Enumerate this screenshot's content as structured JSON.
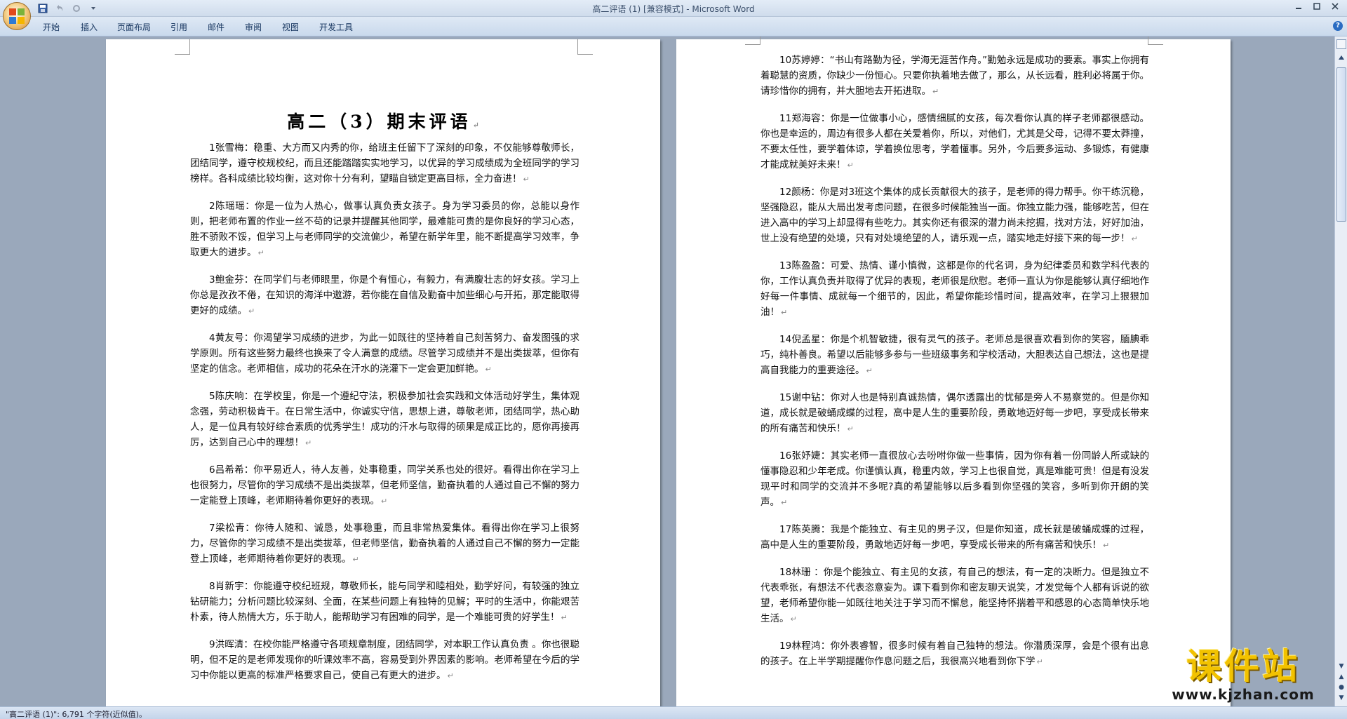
{
  "window": {
    "title": "高二评语 (1) [兼容模式] - Microsoft Word"
  },
  "ribbon": {
    "tabs": [
      "开始",
      "插入",
      "页面布局",
      "引用",
      "邮件",
      "审阅",
      "视图",
      "开发工具"
    ]
  },
  "document": {
    "title": "高二（3）期末评语",
    "page1_paragraphs": [
      "1张雪梅：稳重、大方而又内秀的你，给班主任留下了深刻的印象，不仅能够尊敬师长，团结同学，遵守校规校纪，而且还能踏踏实实地学习，以优异的学习成绩成为全班同学的学习榜样。各科成绩比较均衡，这对你十分有利，望瞄自锁定更高目标，全力奋进！",
      "2陈瑶瑶：你是一位为人热心，做事认真负责女孩子。身为学习委员的你，总能以身作则，把老师布置的作业一丝不苟的记录并提醒其他同学，最难能可贵的是你良好的学习心态，胜不骄败不馁，但学习上与老师同学的交流偏少，希望在新学年里，能不断提高学习效率，争取更大的进步。",
      "3鲍金芬：在同学们与老师眼里，你是个有恒心，有毅力，有满腹壮志的好女孩。学习上你总是孜孜不倦，在知识的海洋中遨游，若你能在自信及勤奋中加些细心与开拓，那定能取得更好的成绩。",
      "4黄友号：你渴望学习成绩的进步，为此一如既往的坚持着自己刻苦努力、奋发图强的求学原则。所有这些努力最终也换来了令人满意的成绩。尽管学习成绩并不是出类拔萃，但你有坚定的信念。老师相信，成功的花朵在汗水的浇灌下一定会更加鲜艳。",
      "5陈庆响：在学校里，你是一个遵纪守法，积极参加社会实践和文体活动好学生，集体观念强，劳动积极肯干。在日常生活中，你诚实守信，思想上进，尊敬老师，团结同学，热心助人，是一位具有较好综合素质的优秀学生！成功的汗水与取得的硕果是成正比的，愿你再接再厉，达到自己心中的理想！",
      "6吕希希：你平易近人，待人友善，处事稳重，同学关系也处的很好。看得出你在学习上也很努力，尽管你的学习成绩不是出类拔萃，但老师坚信，勤奋执着的人通过自己不懈的努力一定能登上顶峰，老师期待着你更好的表现。",
      "7梁松青：你待人随和、诚恳，处事稳重，而且非常热爱集体。看得出你在学习上很努力，尽管你的学习成绩不是出类拔萃，但老师坚信，勤奋执着的人通过自己不懈的努力一定能登上顶峰，老师期待着你更好的表现。",
      "8肖新宇：你能遵守校纪班规，尊敬师长，能与同学和睦相处，勤学好问，有较强的独立钻研能力；分析问题比较深刻、全面，在某些问题上有独特的见解；平时的生活中，你能艰苦朴素，待人热情大方，乐于助人，能帮助学习有困难的同学，是一个难能可贵的好学生！",
      "9洪晖清：在校你能严格遵守各项规章制度，团结同学，对本职工作认真负责 。你也很聪明，但不足的是老师发现你的听课效率不高，容易受到外界因素的影响。老师希望在今后的学习中你能以更高的标准严格要求自己，使自己有更大的进步。"
    ],
    "page2_paragraphs": [
      "10苏婷婷：“书山有路勤为径，学海无涯苦作舟。”勤勉永远是成功的要素。事实上你拥有着聪慧的资质，你缺少一份恒心。只要你执着地去做了，那么，从长远看，胜利必将属于你。请珍惜你的拥有，并大胆地去开拓进取。",
      "11郑海容：你是一位做事小心，感情细腻的女孩，每次看你认真的样子老师都很感动。你也是幸运的，周边有很多人都在关爱着你，所以，对他们，尤其是父母，记得不要太莽撞，不要太任性，要学着体谅，学着换位思考，学着懂事。另外，今后要多运动、多锻炼，有健康才能成就美好未来！",
      "12颜杨：你是对3班这个集体的成长贡献很大的孩子，是老师的得力帮手。你干练沉稳，坚强隐忍，能从大局出发考虑问题，在很多时候能独当一面。你独立能力强，能够吃苦，但在进入高中的学习上却显得有些吃力。其实你还有很深的潜力尚未挖掘，找对方法，好好加油，世上没有绝望的处境，只有对处境绝望的人，请乐观一点，踏实地走好接下来的每一步！",
      "13陈盈盈：可爱、热情、谨小慎微，这都是你的代名词，身为纪律委员和数学科代表的你，工作认真负责并取得了优异的表现，老师很是欣慰。老师一直认为你是能够认真仔细地作好每一件事情、成就每一个细节的，因此，希望你能珍惜时间，提高效率，在学习上狠狠加油！",
      "14倪孟星：你是个机智敏捷，很有灵气的孩子。老师总是很喜欢看到你的笑容，腼腆乖巧，纯朴善良。希望以后能够多参与一些班级事务和学校活动，大胆表达自己想法，这也是提高自我能力的重要途径。",
      "15谢中钻：你对人也是特别真诚热情，偶尔透露出的忧郁是旁人不易察觉的。但是你知道，成长就是破蛹成蝶的过程，高中是人生的重要阶段，勇敢地迈好每一步吧，享受成长带来的所有痛苦和快乐！",
      "16张妤婕：其实老师一直很放心去吩咐你做一些事情，因为你有着一份同龄人所或缺的懂事隐忍和少年老成。你谨慎认真，稳重内敛，学习上也很自觉，真是难能可贵！但是有没发现平时和同学的交流并不多呢?真的希望能够以后多看到你坚强的笑容，多听到你开朗的笑声。",
      "17陈英腾：我是个能独立、有主见的男子汉，但是你知道，成长就是破蛹成蝶的过程，高中是人生的重要阶段，勇敢地迈好每一步吧，享受成长带来的所有痛苦和快乐！",
      "18林珊 ：你是个能独立、有主见的女孩，有自己的想法，有一定的决断力。但是独立不代表乖张，有想法不代表恣意妄为。课下看到你和密友聊天说笑，才发觉每个人都有诉说的欲望，老师希望你能一如既往地关注于学习而不懈怠，能坚持怀揣着平和感恩的心态简单快乐地生活。",
      "19林程鸿：你外表睿智，很多时候有着自己独特的想法。你潜质深厚，会是个很有出息的孩子。在上半学期提醒你作息问题之后，我很高兴地看到你下学"
    ]
  },
  "statusbar": {
    "text": "\"高二评语 (1)\": 6,791 个字符(近似值)。"
  },
  "watermark": {
    "main": "课件站",
    "url": "www.kjzhan.com"
  },
  "colors": {
    "office_orange": "#d98a2a",
    "ribbon_blue": "#c9d9ec",
    "watermark_yellow": "#f2c200"
  }
}
